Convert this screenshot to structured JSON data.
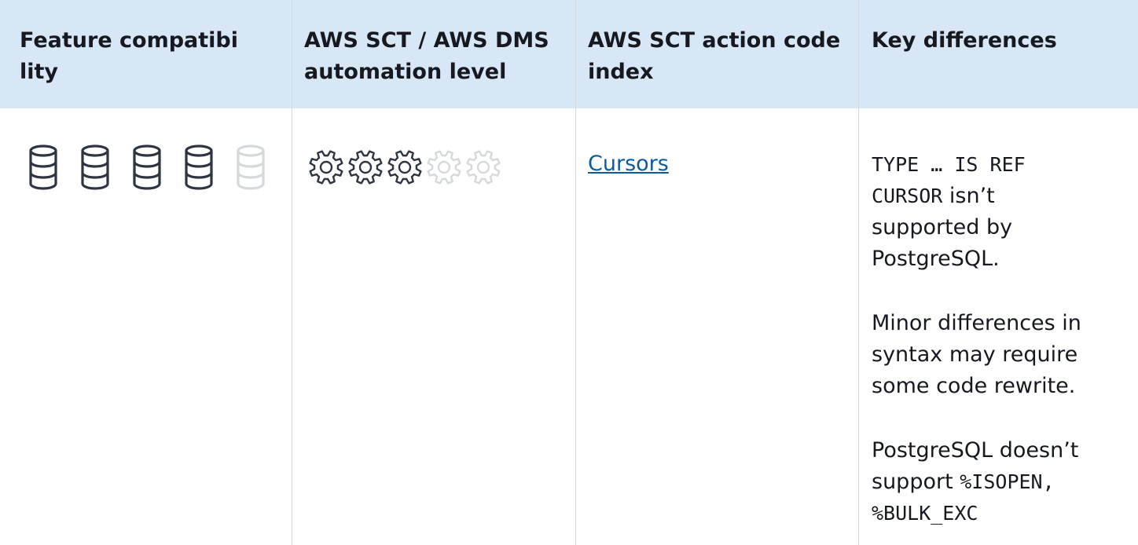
{
  "table": {
    "headers": {
      "col1": "Feature compatibi lity",
      "col2": "AWS SCT / AWS DMS automation level",
      "col3": "AWS SCT action code index",
      "col4": "Key differences"
    },
    "row": {
      "feature_compatibility": {
        "icon": "database-icon",
        "filled": 4,
        "total": 5
      },
      "automation_level": {
        "icon": "gear-icon",
        "filled": 3,
        "total": 5
      },
      "action_code_link": "Cursors",
      "key_differences": {
        "p1_code": "TYPE … IS REF",
        "p1_code2": "CURSOR",
        "p1_text_a": " isn’t",
        "p1_text_b": "supported by",
        "p1_text_c": "PostgreSQL.",
        "p2_line1": "Minor differences in",
        "p2_line2": "syntax may require",
        "p2_line3": "some code rewrite.",
        "p3_line1": "PostgreSQL doesn’t",
        "p3_line2_text": "support ",
        "p3_line2_code": "%ISOPEN,",
        "p3_line3_code": "%BULK_EXC"
      }
    },
    "colors": {
      "header_bg": "#d7e7f6",
      "icon_active": "#2e3440",
      "icon_inactive": "#d6d9dc",
      "link": "#0b5b9e",
      "divider": "#d5d9de"
    }
  }
}
